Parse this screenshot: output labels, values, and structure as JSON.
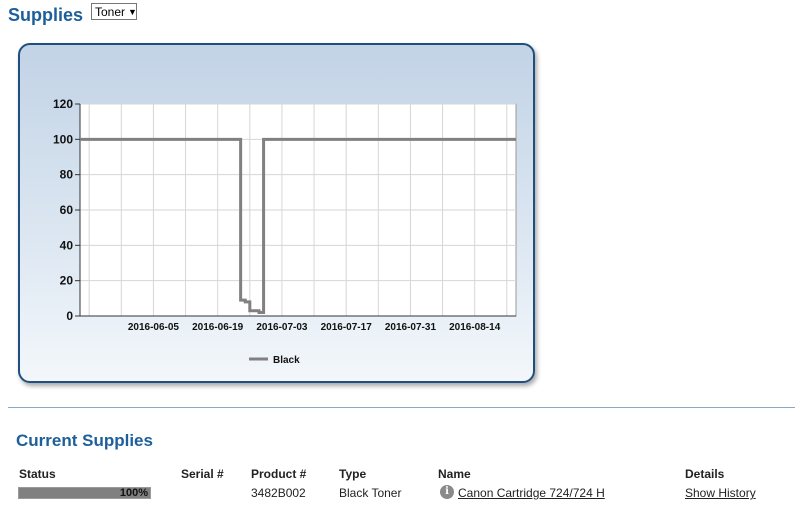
{
  "header": {
    "title": "Supplies",
    "supply_type_select": {
      "selected": "Toner"
    }
  },
  "chart_data": {
    "type": "line",
    "title": "",
    "xlabel": "",
    "ylabel": "",
    "ylim": [
      0,
      120
    ],
    "yticks": [
      0,
      20,
      40,
      60,
      80,
      100,
      120
    ],
    "xlim": [
      "2016-05-20",
      "2016-08-23"
    ],
    "xticks": [
      "2016-06-05",
      "2016-06-19",
      "2016-07-03",
      "2016-07-17",
      "2016-07-31",
      "2016-08-14"
    ],
    "grid": true,
    "legend_position": "bottom-center",
    "series": [
      {
        "name": "Black",
        "color": "#808080",
        "step": true,
        "points": [
          [
            "2016-05-20",
            100
          ],
          [
            "2016-06-23",
            100
          ],
          [
            "2016-06-24",
            9
          ],
          [
            "2016-06-25",
            8
          ],
          [
            "2016-06-26",
            3
          ],
          [
            "2016-06-28",
            2
          ],
          [
            "2016-06-29",
            100
          ],
          [
            "2016-08-23",
            100
          ]
        ]
      }
    ]
  },
  "current_supplies": {
    "title": "Current Supplies",
    "columns": {
      "status": "Status",
      "serial": "Serial #",
      "product": "Product #",
      "type": "Type",
      "name": "Name",
      "details": "Details"
    },
    "rows": [
      {
        "status_percent": 100,
        "status_label": "100%",
        "serial": "",
        "product": "3482B002",
        "type": "Black Toner",
        "name": "Canon Cartridge 724/724 H",
        "details": "Show History",
        "info_icon": "info-icon"
      }
    ]
  }
}
